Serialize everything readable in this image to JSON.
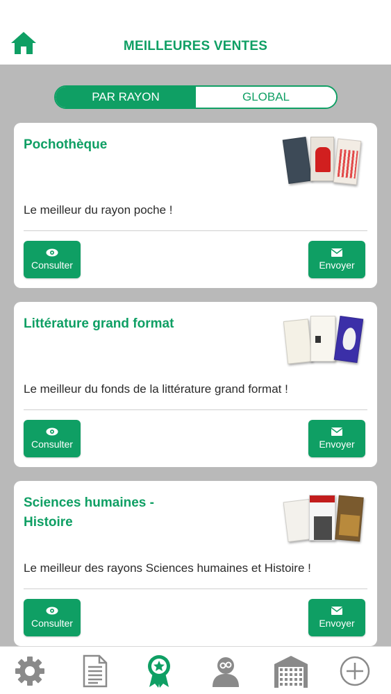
{
  "header": {
    "title": "MEILLEURES VENTES",
    "home_icon": "home-icon"
  },
  "segment": {
    "tabs": [
      {
        "label": "PAR RAYON",
        "active": true
      },
      {
        "label": "GLOBAL",
        "active": false
      }
    ]
  },
  "cards": [
    {
      "title": "Pochothèque",
      "description": "Le meilleur du rayon poche !",
      "consult_label": "Consulter",
      "send_label": "Envoyer"
    },
    {
      "title": "Littérature grand format",
      "description": "Le meilleur du fonds de la littérature grand format !",
      "consult_label": "Consulter",
      "send_label": "Envoyer"
    },
    {
      "title": "Sciences humaines - Histoire",
      "description": "Le meilleur des rayons Sciences humaines et Histoire !",
      "consult_label": "Consulter",
      "send_label": "Envoyer"
    }
  ],
  "tabbar": {
    "items": [
      "settings-gear-icon",
      "document-icon",
      "award-ribbon-icon",
      "user-profile-icon",
      "store-building-icon",
      "add-circle-icon"
    ],
    "active_index": 2
  },
  "colors": {
    "accent": "#0f9f64",
    "background": "#b9b9b9",
    "tab_inactive": "#8a8a8a"
  }
}
